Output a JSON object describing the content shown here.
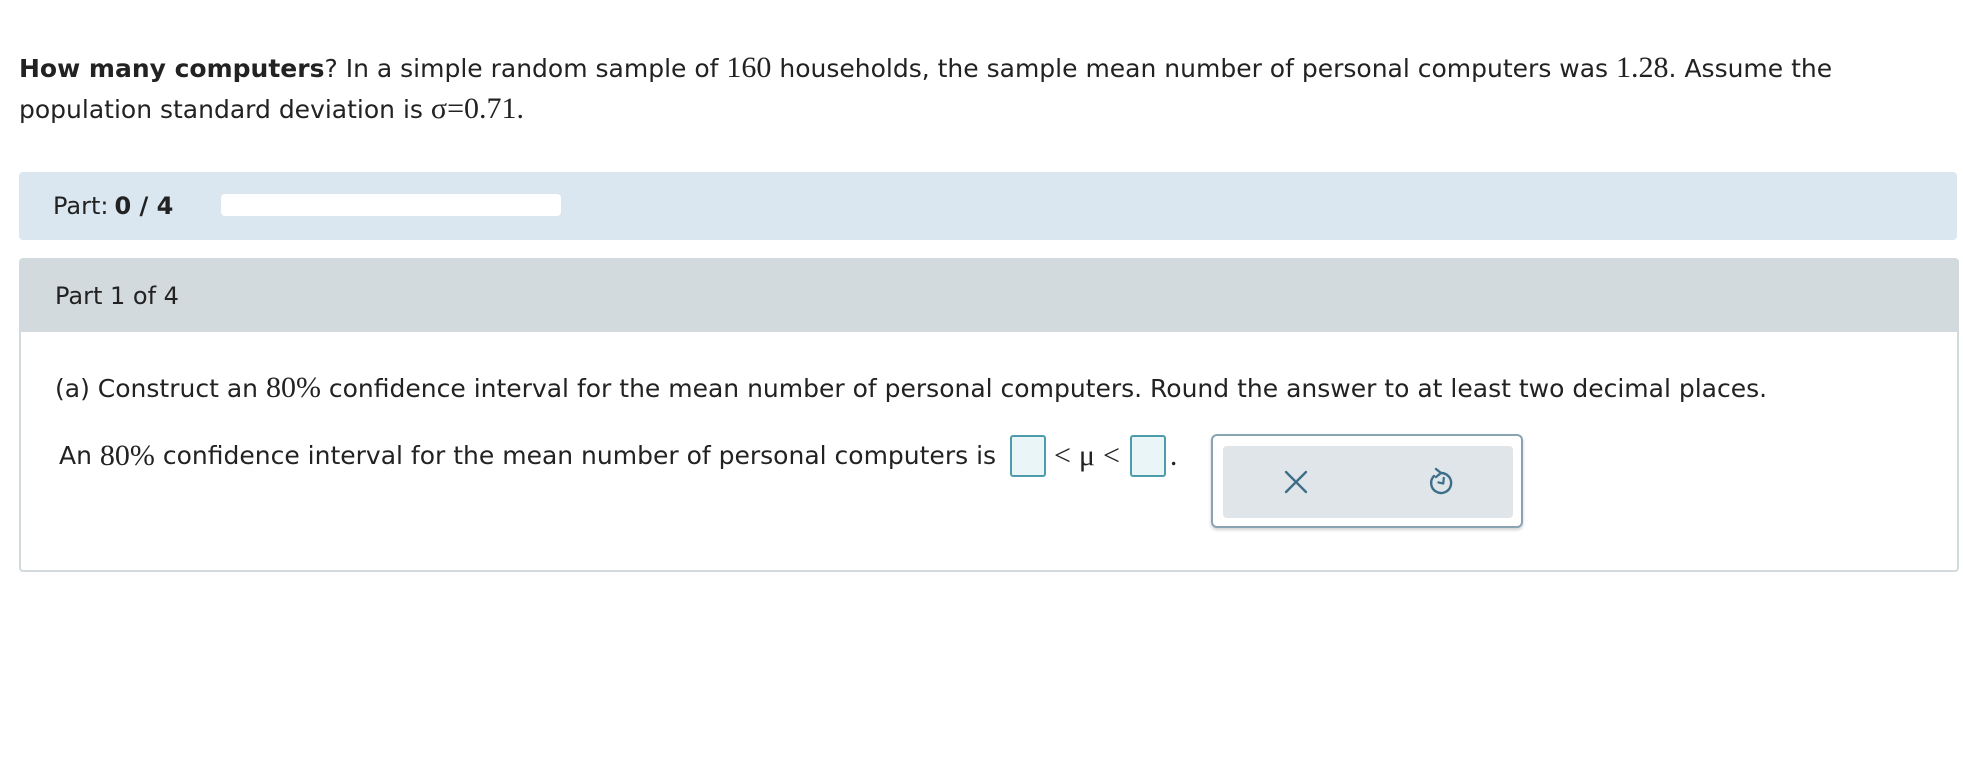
{
  "intro": {
    "title_bold": "How many computers",
    "title_punct": "?",
    "text_a": "In a simple random sample of",
    "sample_size": "160",
    "text_b": "households, the sample mean number of personal computers was",
    "sample_mean": "1.28",
    "text_c": ". Assume the population standard deviation is",
    "sigma_symbol": "σ",
    "equals": "=",
    "sigma_value": "0.71",
    "end_period": "."
  },
  "progress": {
    "label": "Part:",
    "count": "0 / 4",
    "completed_fraction": 0
  },
  "part": {
    "title": "Part 1 of 4",
    "question_prefix": "(a) Construct an",
    "confidence": "80%",
    "question_suffix": "confidence interval for the mean number of personal computers. Round the answer to at least two decimal places.",
    "answer_prefix": "An",
    "answer_confidence": "80%",
    "answer_text": "confidence interval for the mean number of personal computers is",
    "lower_value": "",
    "less_than_1": "<",
    "mu_symbol": "μ",
    "less_than_2": "<",
    "upper_value": "",
    "answer_end": "."
  },
  "tools": {
    "clear_icon": "close-icon",
    "undo_icon": "undo-icon",
    "icon_color": "#3d6e8a"
  },
  "colors": {
    "progress_band": "#dbe7f0",
    "part_header": "#d3dadd",
    "input_border": "#4d9cac",
    "input_fill": "#eaf5f8"
  }
}
